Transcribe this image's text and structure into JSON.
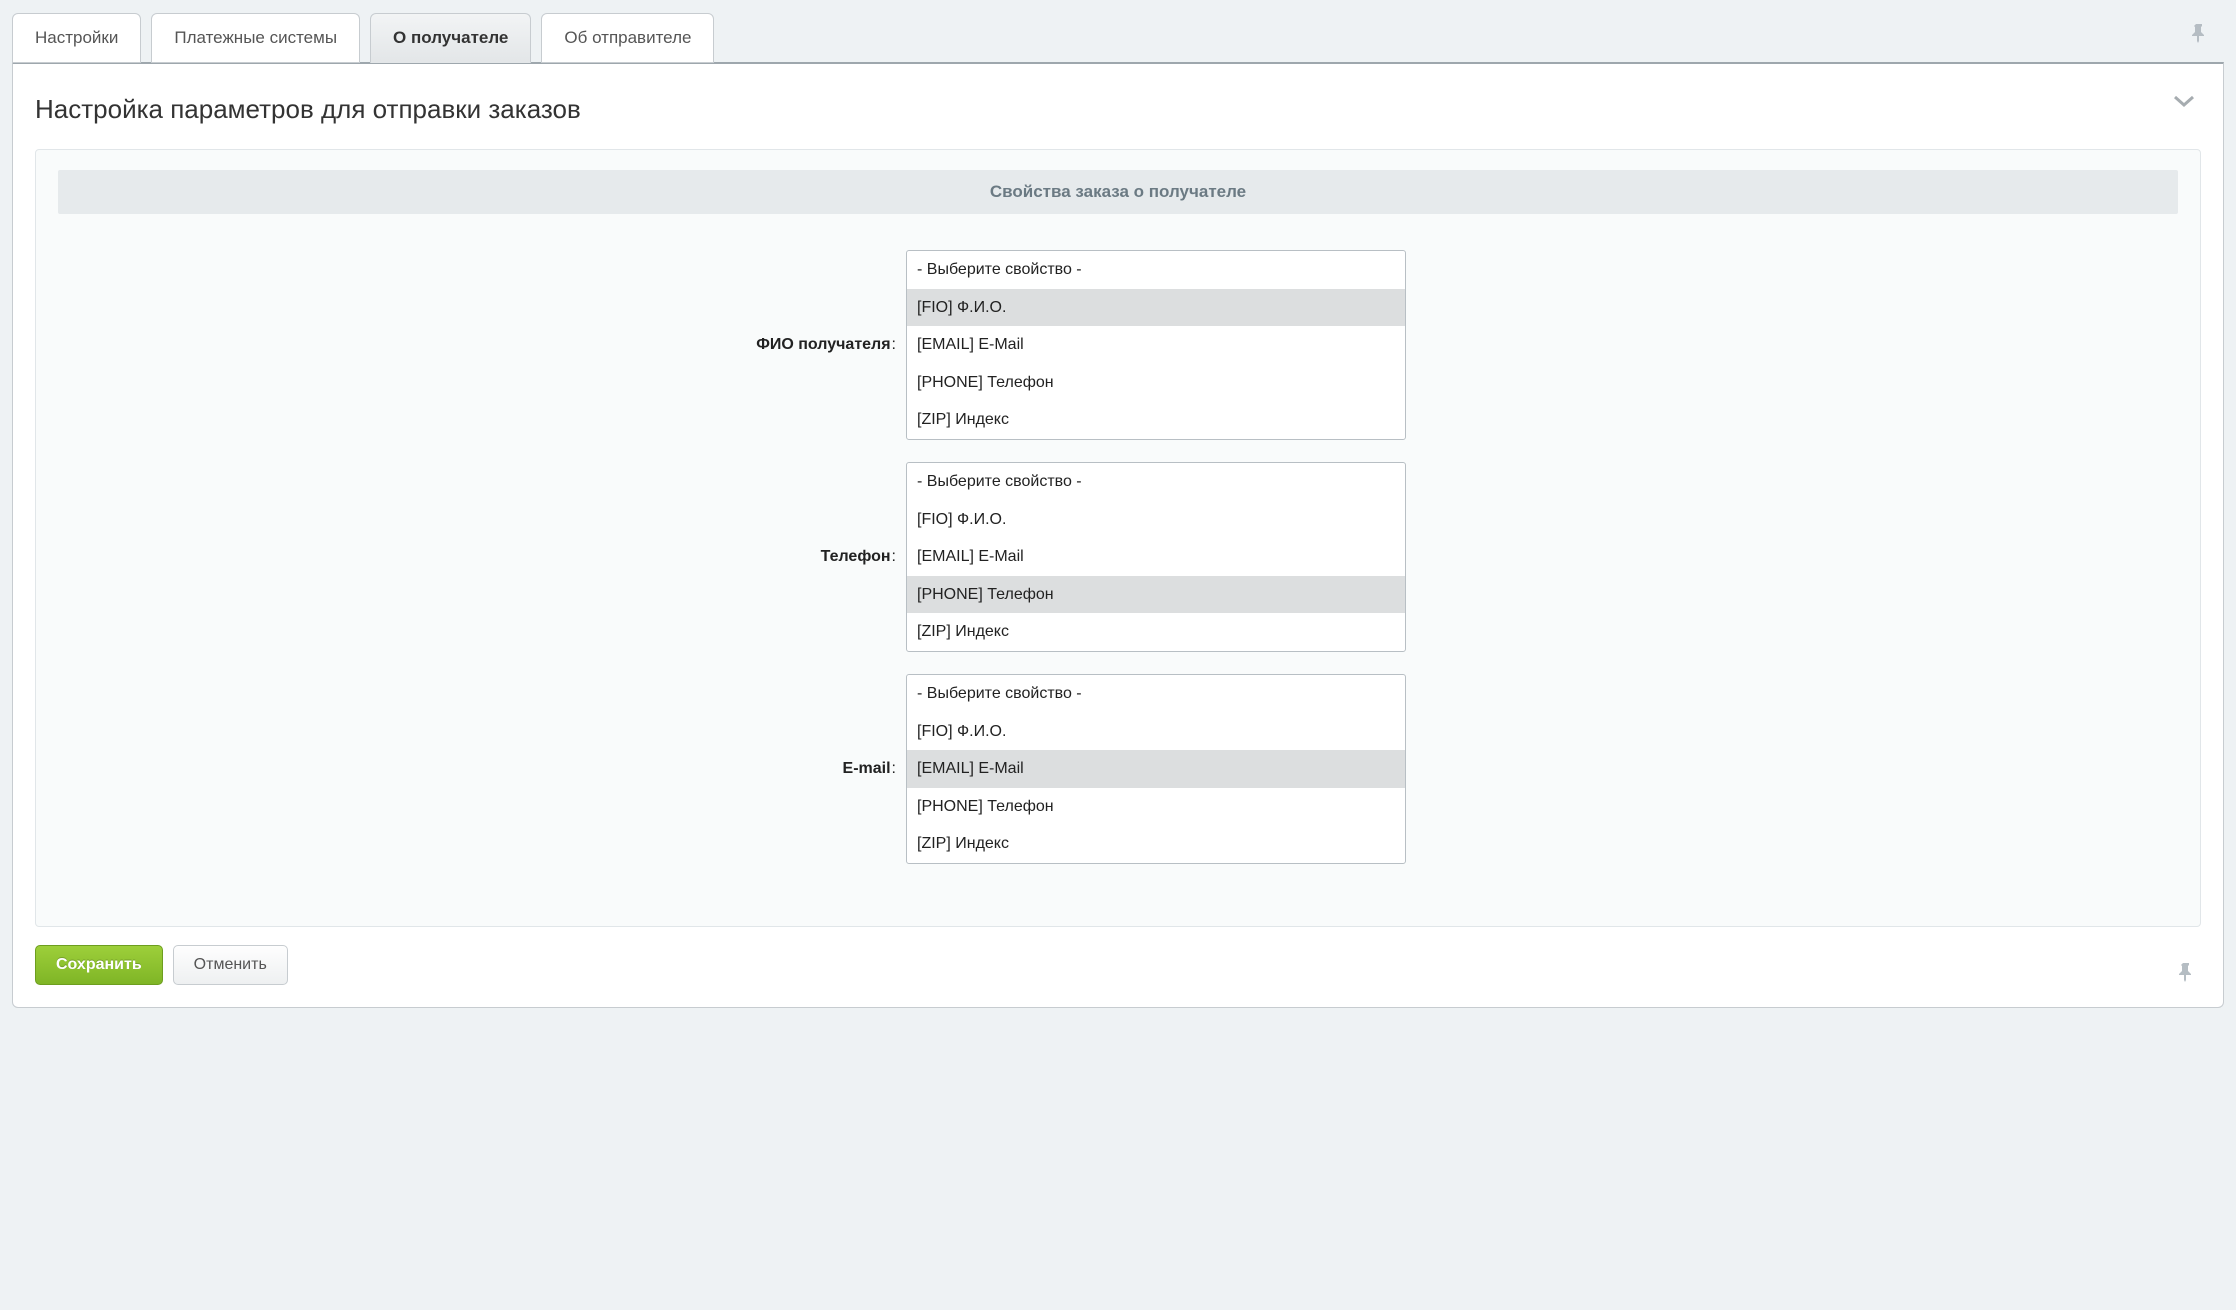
{
  "tabs": [
    {
      "label": "Настройки"
    },
    {
      "label": "Платежные системы"
    },
    {
      "label": "О получателе"
    },
    {
      "label": "Об отправителе"
    }
  ],
  "panel": {
    "title": "Настройка параметров для отправки заказов"
  },
  "section": {
    "header": "Свойства заказа о получателе"
  },
  "fields": {
    "fio": {
      "label": "ФИО получателя",
      "options": [
        "- Выберите свойство -",
        "[FIO] Ф.И.О.",
        "[EMAIL] E-Mail",
        "[PHONE] Телефон",
        "[ZIP] Индекс"
      ],
      "selected_index": 1
    },
    "phone": {
      "label": "Телефон",
      "options": [
        "- Выберите свойство -",
        "[FIO] Ф.И.О.",
        "[EMAIL] E-Mail",
        "[PHONE] Телефон",
        "[ZIP] Индекс"
      ],
      "selected_index": 3
    },
    "email": {
      "label": "E-mail",
      "options": [
        "- Выберите свойство -",
        "[FIO] Ф.И.О.",
        "[EMAIL] E-Mail",
        "[PHONE] Телефон",
        "[ZIP] Индекс"
      ],
      "selected_index": 2
    }
  },
  "buttons": {
    "save": "Сохранить",
    "cancel": "Отменить"
  }
}
